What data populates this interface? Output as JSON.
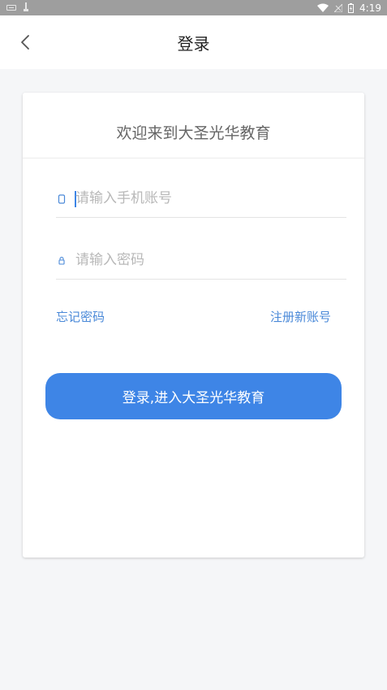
{
  "status_bar": {
    "time": "4:19",
    "icons": [
      "keyboard-icon",
      "usb-icon",
      "wifi-icon",
      "signal-icon",
      "battery-icon"
    ]
  },
  "header": {
    "title": "登录",
    "back_icon": "chevron-left-icon"
  },
  "card": {
    "heading": "欢迎来到大圣光华教育",
    "phone_field": {
      "placeholder": "请输入手机账号",
      "value": "",
      "icon": "phone-icon"
    },
    "password_field": {
      "placeholder": "请输入密码",
      "value": "",
      "icon": "lock-icon"
    },
    "forgot_password": "忘记密码",
    "register": "注册新账号",
    "login_button": "登录,进入大圣光华教育"
  },
  "colors": {
    "accent": "#3e85e6",
    "link": "#4a89d8",
    "background": "#f5f6f8",
    "status_bar": "#9e9e9e"
  }
}
